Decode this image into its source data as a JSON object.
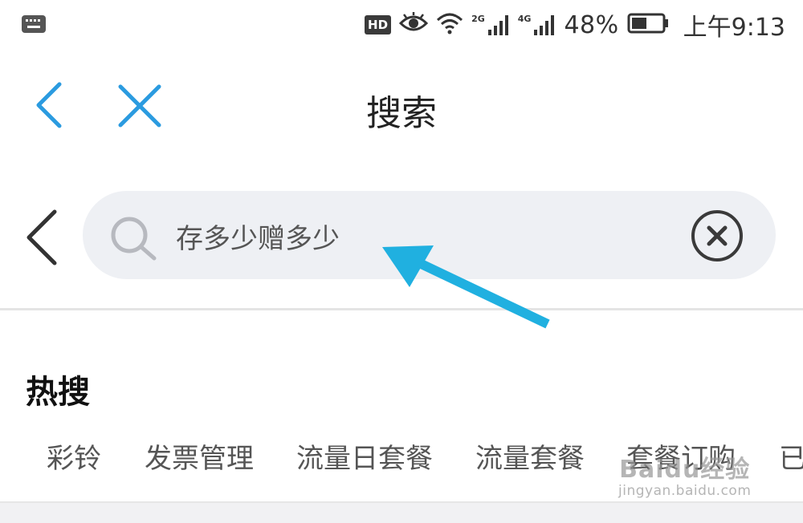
{
  "status_bar": {
    "hd_label": "HD",
    "net_a": "2G",
    "net_b": "4G",
    "battery": "48%",
    "time": "上午9:13",
    "icons": [
      "keyboard-icon",
      "eye-icon",
      "wifi-icon",
      "signal-icon",
      "battery-icon"
    ]
  },
  "nav": {
    "title": "搜索",
    "icons": [
      "back-arrow-icon",
      "close-icon"
    ]
  },
  "search": {
    "value": "存多少赠多少",
    "icons": [
      "search-icon",
      "clear-circle-icon"
    ]
  },
  "hot": {
    "heading": "热搜",
    "tags": [
      "彩铃",
      "发票管理",
      "流量日套餐",
      "流量套餐",
      "套餐订购",
      "已"
    ]
  },
  "watermark": {
    "brand": "Baidu经验",
    "url": "jingyan.baidu.com"
  },
  "colors": {
    "accent_blue": "#2b9be0",
    "annotation_arrow": "#20b0e0",
    "search_bg": "#eef0f4"
  }
}
